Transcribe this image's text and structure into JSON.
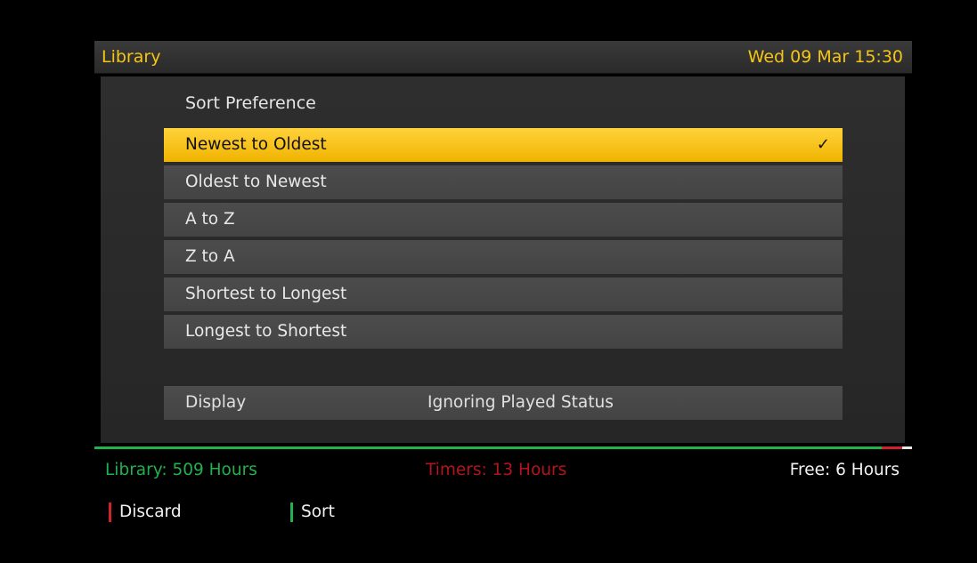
{
  "header": {
    "title": "Library",
    "clock": "Wed 09 Mar 15:30"
  },
  "sort_preference": {
    "title": "Sort Preference",
    "options": [
      {
        "label": "Newest to Oldest",
        "selected": true
      },
      {
        "label": "Oldest to Newest",
        "selected": false
      },
      {
        "label": "A to Z",
        "selected": false
      },
      {
        "label": "Z to A",
        "selected": false
      },
      {
        "label": "Shortest to Longest",
        "selected": false
      },
      {
        "label": "Longest to Shortest",
        "selected": false
      }
    ],
    "check_mark": "✓"
  },
  "display": {
    "label": "Display",
    "value": "Ignoring Played Status"
  },
  "status": {
    "library": "Library: 509 Hours",
    "timers": "Timers: 13 Hours",
    "free": "Free: 6 Hours",
    "capacity_fractions": {
      "library": 0.963,
      "timers": 0.025,
      "free": 0.012
    }
  },
  "colors": {
    "accent": "#f5c516",
    "selected_row": "#f7c21a",
    "library": "#22b14c",
    "timers": "#b3151c",
    "free": "#f2f2f2"
  },
  "keys": [
    {
      "color": "red",
      "label": "Discard"
    },
    {
      "color": "green",
      "label": "Sort"
    }
  ]
}
